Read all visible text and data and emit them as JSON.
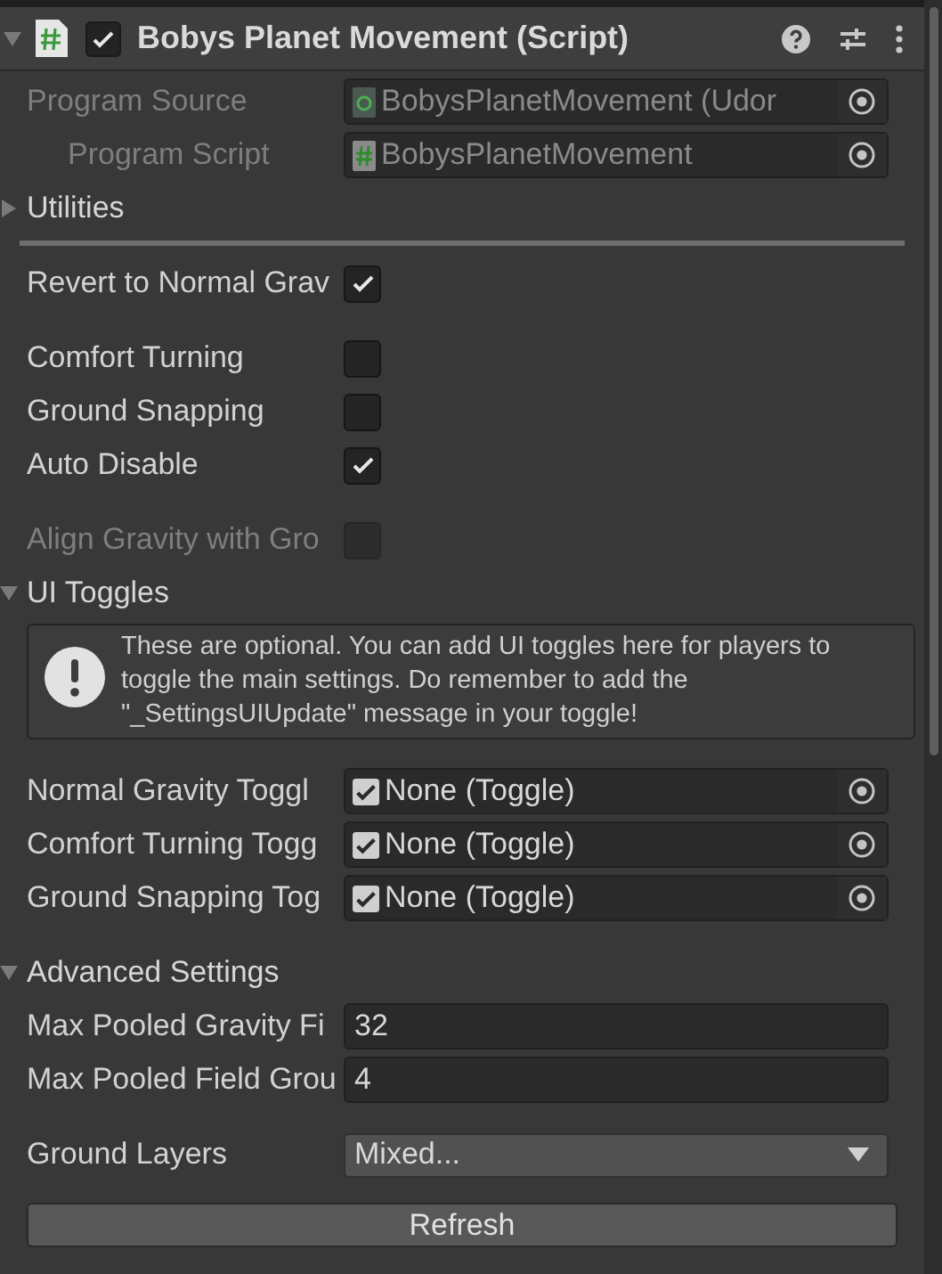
{
  "header": {
    "title": "Bobys Planet Movement (Script)",
    "enabled": true
  },
  "rows": [
    {
      "kind": "asset_field",
      "label": "Program Source",
      "value": "BobysPlanetMovement (Udor",
      "disabled": true,
      "children": [
        {
          "kind": "script_field",
          "label": "Program Script",
          "value": "BobysPlanetMovement",
          "disabled": true
        }
      ]
    },
    {
      "kind": "foldout",
      "label": "Utilities",
      "expanded": false
    },
    {
      "kind": "separator"
    },
    {
      "kind": "checkbox",
      "label": "Revert to Normal Grav",
      "checked": true,
      "disabled": false
    },
    {
      "kind": "checkbox",
      "label": "Comfort Turning",
      "checked": false,
      "disabled": false
    },
    {
      "kind": "checkbox",
      "label": "Ground Snapping",
      "checked": false,
      "disabled": false
    },
    {
      "kind": "checkbox",
      "label": "Auto Disable",
      "checked": true,
      "disabled": false
    },
    {
      "kind": "checkbox",
      "label": "Align Gravity with Gro",
      "checked": false,
      "disabled": true
    },
    {
      "kind": "foldout",
      "label": "UI Toggles",
      "expanded": true
    },
    {
      "kind": "help",
      "text": "These are optional. You can add UI toggles here for players to toggle the main settings. Do remember to add the \"_SettingsUIUpdate\" message in your toggle!"
    },
    {
      "kind": "toggle_field",
      "label": "Normal Gravity Toggl",
      "value": "None (Toggle)"
    },
    {
      "kind": "toggle_field",
      "label": "Comfort Turning Togg",
      "value": "None (Toggle)"
    },
    {
      "kind": "toggle_field",
      "label": "Ground Snapping Tog",
      "value": "None (Toggle)"
    },
    {
      "kind": "foldout",
      "label": "Advanced Settings",
      "expanded": true
    },
    {
      "kind": "number",
      "label": "Max Pooled Gravity Fi",
      "value": "32"
    },
    {
      "kind": "number",
      "label": "Max Pooled Field Grou",
      "value": "4"
    },
    {
      "kind": "dropdown",
      "label": "Ground Layers",
      "value": "Mixed..."
    },
    {
      "kind": "button",
      "label": "Refresh"
    }
  ]
}
